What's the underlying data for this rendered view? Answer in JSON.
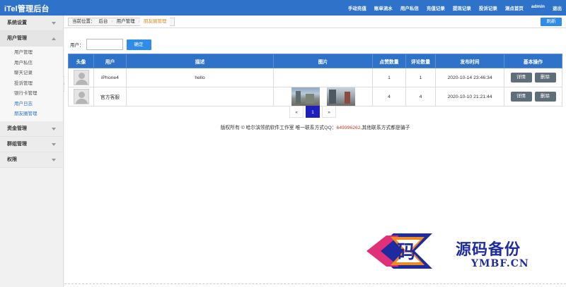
{
  "app": {
    "title": "iTel管理后台"
  },
  "topnav": [
    "手动充值",
    "账单流水",
    "用户私信",
    "充值记录",
    "提现记录",
    "投诉记录",
    "测点首页",
    "admin",
    "退出"
  ],
  "sidebar": {
    "groups": [
      {
        "label": "系统设置",
        "open": false,
        "items": []
      },
      {
        "label": "用户管理",
        "open": true,
        "items": [
          {
            "label": "用户管理",
            "active": false
          },
          {
            "label": "用户私信",
            "active": false
          },
          {
            "label": "聊天记录",
            "active": false
          },
          {
            "label": "投诉管理",
            "active": false
          },
          {
            "label": "银行卡管理",
            "active": false
          },
          {
            "label": "用户日志",
            "active": true
          },
          {
            "label": "朋友圈管理",
            "active": true
          }
        ]
      },
      {
        "label": "资金管理",
        "open": false,
        "items": []
      },
      {
        "label": "群组管理",
        "open": false,
        "items": []
      },
      {
        "label": "权限",
        "open": false,
        "items": []
      }
    ]
  },
  "breadcrumb": {
    "prefix": "当前位置：",
    "root": "后台",
    "parent": "用户管理",
    "current": "朋友圈管理"
  },
  "toolbar": {
    "refresh_label": "刷新"
  },
  "search": {
    "label": "用户：",
    "value": "",
    "placeholder": "",
    "confirm_label": "确定"
  },
  "table": {
    "headers": [
      "头像",
      "用户",
      "描述",
      "图片",
      "点赞数量",
      "评论数量",
      "发布时间",
      "基本操作"
    ],
    "rows": [
      {
        "user": "iPhone4",
        "desc": "hello",
        "image_count": 0,
        "likes": "1",
        "comments": "1",
        "time": "2020-10-14 23:46:34",
        "btn_detail": "详情",
        "btn_delete": "删除"
      },
      {
        "user": "官方客服",
        "desc": "",
        "image_count": 2,
        "likes": "4",
        "comments": "4",
        "time": "2020-10-10 21:21:44",
        "btn_detail": "详情",
        "btn_delete": "删除"
      }
    ]
  },
  "pager": {
    "prev": "«",
    "current": "1",
    "next": "»"
  },
  "footer": {
    "text_before": "版权所有 © 哈尔滨领航软件工作室 唯一联系方式QQ：",
    "qq": "649396262",
    "text_after": ",其他联系方式都是骗子"
  },
  "watermark": {
    "glyph": "码",
    "title": "源码备份",
    "domain": "YMBF.CN"
  },
  "colors": {
    "primary": "#2f72c9",
    "button": "#2f8ce9",
    "op_button": "#5f6f7a",
    "active_link": "#2f72c9",
    "crumb_current": "#e28a2c",
    "qq": "#c5392c"
  }
}
